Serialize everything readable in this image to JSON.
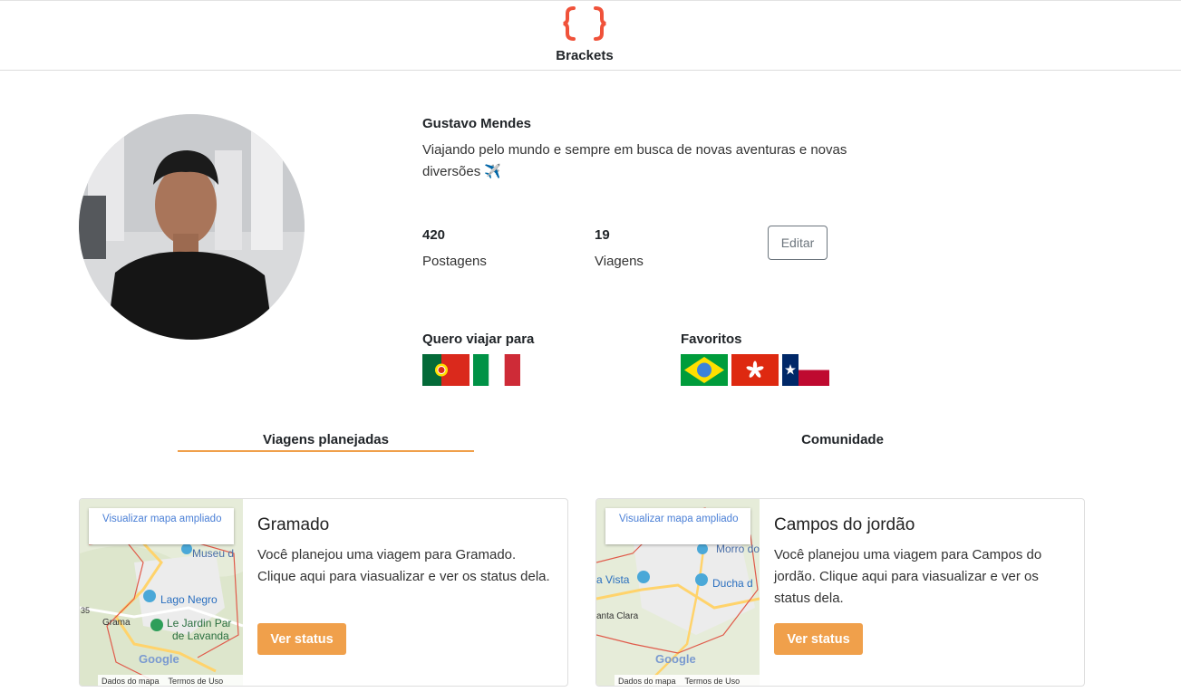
{
  "header": {
    "logo_glyph": "{ }",
    "brand": "Brackets",
    "accent": "#f0523a"
  },
  "profile": {
    "name": "Gustavo Mendes",
    "bio": "Viajando pelo mundo e sempre em busca de novas aventuras e novas diversões ✈️",
    "stats": [
      {
        "value": "420",
        "label": "Postagens"
      },
      {
        "value": "19",
        "label": "Viagens"
      }
    ],
    "edit_label": "Editar"
  },
  "wishlist": {
    "title": "Quero viajar para",
    "flags": [
      "portugal-flag",
      "italy-flag"
    ]
  },
  "favorites": {
    "title": "Favoritos",
    "flags": [
      "brazil-flag",
      "hong-kong-flag",
      "texas-flag"
    ]
  },
  "tabs": [
    {
      "label": "Viagens planejadas",
      "active": true
    },
    {
      "label": "Comunidade",
      "active": false
    }
  ],
  "trips": [
    {
      "title": "Gramado",
      "text": "Você planejou uma viagem para Gramado. Clique aqui para viasualizar e ver os status dela.",
      "button": "Ver status",
      "map": {
        "link": "Visualizar mapa ampliado",
        "places": [
          "Museu d",
          "Lago Negro",
          "Le Jardin Par",
          "de Lavanda",
          "Grama",
          "35"
        ],
        "footer": [
          "Dados do mapa",
          "Termos de Uso"
        ],
        "google": "Google"
      }
    },
    {
      "title": "Campos do jordão",
      "text": "Você planejou uma viagem para Campos do jordão. Clique aqui para viasualizar e ver os status dela.",
      "button": "Ver status",
      "map": {
        "link": "Visualizar mapa ampliado",
        "places": [
          "Morro do",
          "a Vista",
          "Ducha d",
          "anta Clara"
        ],
        "footer": [
          "Dados do mapa",
          "Termos de Uso"
        ],
        "google": "Google"
      }
    }
  ],
  "colors": {
    "button": "#f0a04b",
    "tab_underline": "#f0a04b"
  }
}
